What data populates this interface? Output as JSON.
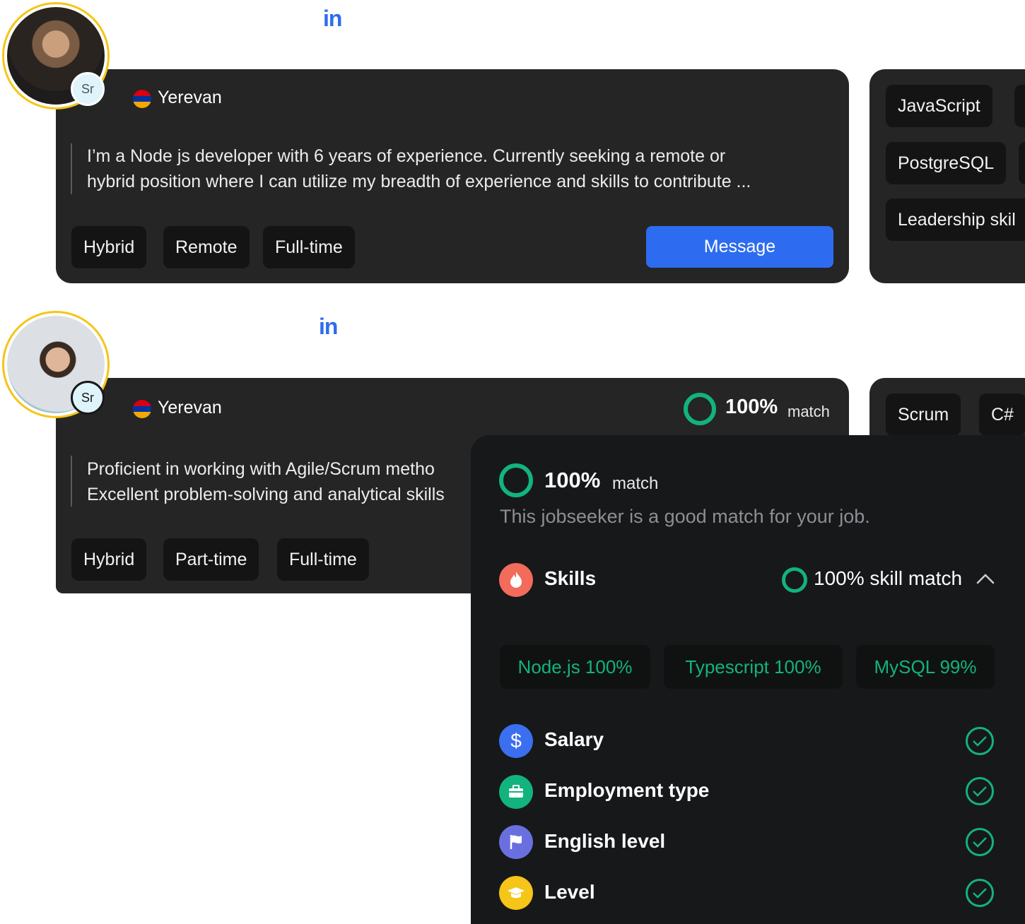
{
  "cards": [
    {
      "avatar_level": "Sr",
      "social_label": "in",
      "city": "Yerevan",
      "bio": [
        "I’m a Node js developer with 6 years of experience. Currently seeking a remote or",
        "hybrid position where I can utilize my breadth of experience and skills to contribute ..."
      ],
      "tags": [
        "Hybrid",
        "Remote",
        "Full-time"
      ],
      "message_label": "Message",
      "skills": [
        "JavaScript",
        "PostgreSQL",
        "Leadership skil"
      ]
    },
    {
      "avatar_level": "Sr",
      "social_label": "in",
      "city": "Yerevan",
      "match_pct": "100%",
      "match_word": "match",
      "bio": [
        "Proficient in working with Agile/Scrum metho",
        "Excellent problem-solving and analytical skills"
      ],
      "tags": [
        "Hybrid",
        "Part-time",
        "Full-time"
      ],
      "skills": [
        "Scrum",
        "C#"
      ]
    }
  ],
  "match_panel": {
    "pct": "100%",
    "word": "match",
    "subtitle": "This jobseeker is a good match for your job.",
    "skills_label": "Skills",
    "skill_match": "100% skill match",
    "chips": [
      "Node.js 100%",
      "Typescript 100%",
      "MySQL 99%"
    ],
    "criteria": [
      {
        "label": "Salary",
        "icon": "dollar-icon",
        "color": "#3b6ff0"
      },
      {
        "label": "Employment type",
        "icon": "briefcase-icon",
        "color": "#12b37c"
      },
      {
        "label": "English level",
        "icon": "flag-icon",
        "color": "#6a6fe0"
      },
      {
        "label": "Level",
        "icon": "graduation-cap-icon",
        "color": "#f5c518"
      }
    ]
  },
  "colors": {
    "accent_blue": "#2d6cf0",
    "match_green": "#12b37c",
    "card_bg": "#252526",
    "panel_bg": "#17181a",
    "avatar_ring": "#f5c518"
  }
}
